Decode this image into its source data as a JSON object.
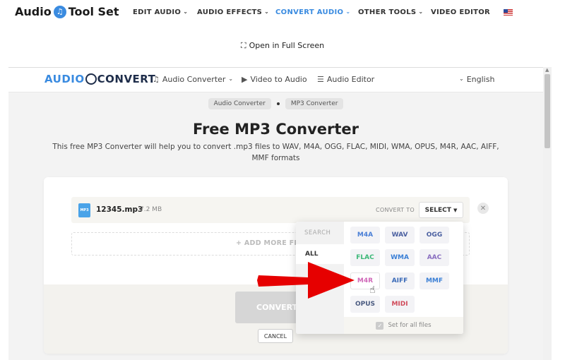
{
  "site": {
    "logo_text": "Audio",
    "logo_text2": "Tool Set",
    "nav": [
      {
        "label": "EDIT AUDIO"
      },
      {
        "label": "AUDIO EFFECTS"
      },
      {
        "label": "CONVERT AUDIO"
      },
      {
        "label": "OTHER TOOLS"
      },
      {
        "label": "VIDEO EDITOR"
      }
    ],
    "fullscreen_label": "Open in Full Screen"
  },
  "app": {
    "logo_part1": "AUDIO",
    "logo_part2": "CONVERT",
    "nav": {
      "audio_converter": "Audio Converter",
      "video_to_audio": "Video to Audio",
      "audio_editor": "Audio Editor",
      "language": "English"
    },
    "breadcrumbs": [
      "Audio Converter",
      "MP3 Converter"
    ],
    "title": "Free MP3 Converter",
    "description": "This free MP3 Converter will help you to convert .mp3 files to WAV, M4A, OGG, FLAC, MIDI, WMA, OPUS, M4R, AAC, AIFF, MMF formats"
  },
  "file": {
    "icon_label": "MP3",
    "name": "12345.mp3",
    "size": "7.2 MB",
    "convert_to_label": "CONVERT TO",
    "select_label": "SELECT"
  },
  "add_more_label": "+ ADD MORE FIL",
  "convert_label": "CONVERT",
  "cancel_label": "CANCEL",
  "dropdown": {
    "search_label": "SEARCH",
    "all_label": "ALL",
    "formats": [
      {
        "label": "M4A",
        "color": "#4a7fd6"
      },
      {
        "label": "WAV",
        "color": "#4a5fa0"
      },
      {
        "label": "OGG",
        "color": "#4a5fa0"
      },
      {
        "label": "FLAC",
        "color": "#3cb878"
      },
      {
        "label": "WMA",
        "color": "#3a7fd6"
      },
      {
        "label": "AAC",
        "color": "#8a6fc0"
      },
      {
        "label": "M4R",
        "color": "#d068b8"
      },
      {
        "label": "AIFF",
        "color": "#3a6ab8"
      },
      {
        "label": "MMF",
        "color": "#3a7fd6"
      },
      {
        "label": "OPUS",
        "color": "#4a5a80"
      },
      {
        "label": "MIDI",
        "color": "#d04a5a"
      }
    ],
    "set_all_label": "Set for all files"
  },
  "colors": {
    "accent": "#3a8be0",
    "arrow": "#e60000"
  }
}
